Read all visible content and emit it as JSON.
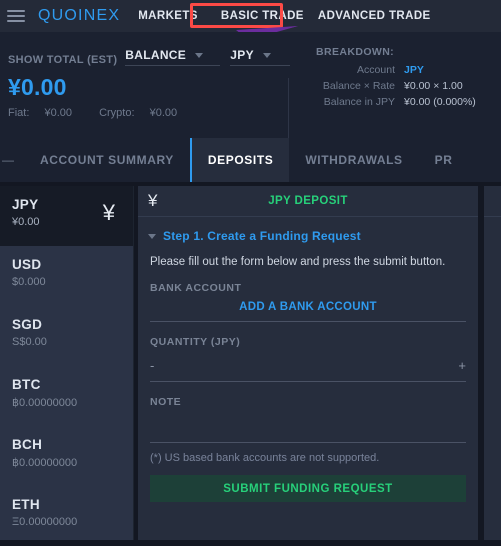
{
  "topnav": {
    "menu_icon": "hamburger-icon",
    "logo": "QUOINEX",
    "items": [
      {
        "label": "MARKETS"
      },
      {
        "label": "BASIC TRADE"
      },
      {
        "label": "ADVANCED TRADE"
      }
    ]
  },
  "annotations": {
    "highlight_box_color": "#fc4a46",
    "highlight_target": "BASIC TRADE",
    "arrow_color": "#6b2d9e"
  },
  "balance_bar": {
    "show_total_label": "SHOW TOTAL (EST)",
    "balance_dropdown": "BALANCE",
    "currency_dropdown": "JPY",
    "total": "¥0.00",
    "fiat_label": "Fiat:",
    "fiat_value": "¥0.00",
    "crypto_label": "Crypto:",
    "crypto_value": "¥0.00",
    "breakdown": {
      "title": "BREAKDOWN:",
      "rows": [
        {
          "key": "Account",
          "value": "JPY",
          "accent": true
        },
        {
          "key": "Balance × Rate",
          "value": "¥0.00 × 1.00",
          "accent": false
        },
        {
          "key": "Balance in JPY",
          "value": "¥0.00 (0.000%)",
          "accent": false
        }
      ]
    }
  },
  "tabs": {
    "leading_dash": "—",
    "items": [
      {
        "label": "ACCOUNT SUMMARY",
        "active": false
      },
      {
        "label": "DEPOSITS",
        "active": true
      },
      {
        "label": "WITHDRAWALS",
        "active": false
      },
      {
        "label": "PR",
        "active": false
      }
    ]
  },
  "currency_sidebar": [
    {
      "code": "JPY",
      "amount": "¥0.00",
      "symbol": "¥",
      "active": true
    },
    {
      "code": "USD",
      "amount": "$0.000",
      "symbol": "",
      "active": false
    },
    {
      "code": "SGD",
      "amount": "S$0.00",
      "symbol": "",
      "active": false
    },
    {
      "code": "BTC",
      "amount": "฿0.00000000",
      "symbol": "",
      "active": false
    },
    {
      "code": "BCH",
      "amount": "฿0.00000000",
      "symbol": "",
      "active": false
    },
    {
      "code": "ETH",
      "amount": "Ξ0.00000000",
      "symbol": "",
      "active": false
    }
  ],
  "deposit_panel": {
    "header_symbol": "¥",
    "title": "JPY DEPOSIT",
    "step_label": "Step 1. Create a Funding Request",
    "instruction": "Please fill out the form below and press the submit button.",
    "bank_account_label": "BANK ACCOUNT",
    "add_bank_account": "ADD A BANK ACCOUNT",
    "quantity_label": "QUANTITY (JPY)",
    "quantity_decrement": "-",
    "quantity_increment": "+",
    "quantity_value": "",
    "note_label": "NOTE",
    "note_value": "",
    "disclaimer": "(*) US based bank accounts are not supported.",
    "submit_label": "SUBMIT FUNDING REQUEST"
  }
}
